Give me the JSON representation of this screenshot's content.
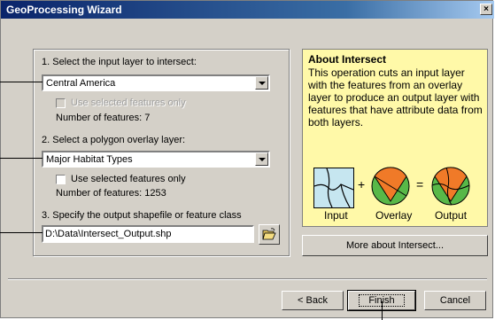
{
  "window": {
    "title": "GeoProcessing Wizard",
    "close_glyph": "×"
  },
  "step1": {
    "label": "1. Select the input layer to intersect:",
    "selected": "Central America",
    "checkbox_label": "Use selected features only",
    "feature_count": "Number of features: 7"
  },
  "step2": {
    "label": "2. Select a polygon overlay layer:",
    "selected": "Major Habitat Types",
    "checkbox_label": "Use selected features only",
    "feature_count": "Number of features: 1253"
  },
  "step3": {
    "label": "3. Specify the output shapefile or feature class",
    "value": "D:\\Data\\Intersect_Output.shp",
    "browse_icon": "folder-open-icon"
  },
  "about": {
    "title": "About Intersect",
    "text": "This operation cuts an input layer with the features from an overlay layer to produce an output layer with features that have attribute data from both layers.",
    "diagram": {
      "input_label": "Input",
      "overlay_label": "Overlay",
      "output_label": "Output",
      "plus": "+",
      "equals": "="
    },
    "colors": {
      "panel": "#fff9a8",
      "overlay_orange": "#f07a28",
      "overlay_green": "#58b848",
      "input_fill": "#c6e6f0"
    }
  },
  "buttons": {
    "more": "More about Intersect...",
    "back": "< Back",
    "finish": "Finish",
    "cancel": "Cancel"
  }
}
